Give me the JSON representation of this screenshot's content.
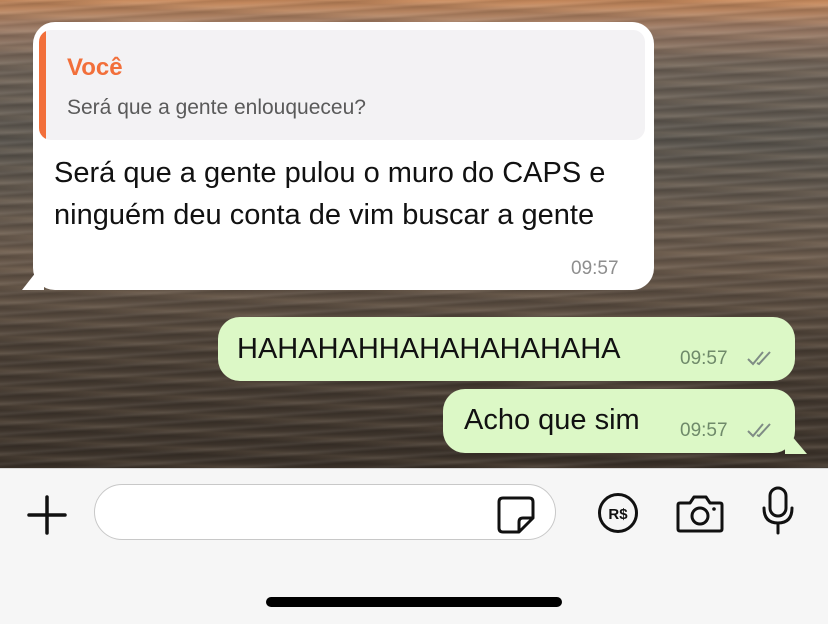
{
  "messages": {
    "incoming": {
      "quote_author": "Você",
      "quote_text": "Será que a gente enlouqueceu?",
      "text": "Será que a gente pulou o muro do CAPS e ninguém deu conta de vim buscar a gente",
      "time": "09:57"
    },
    "outgoing": [
      {
        "text": "HAHAHAHHAHAHAHAHAHA",
        "time": "09:57",
        "status": "read"
      },
      {
        "text": "Acho que sim",
        "time": "09:57",
        "status": "read"
      }
    ]
  },
  "input": {
    "value": "",
    "placeholder": ""
  },
  "icons": [
    "plus-icon",
    "sticker-icon",
    "money-icon",
    "camera-icon",
    "microphone-icon"
  ],
  "colors": {
    "outgoing_bubble": "#dcf8c6",
    "incoming_bubble": "#ffffff",
    "quote_accent": "#f26f3a"
  }
}
